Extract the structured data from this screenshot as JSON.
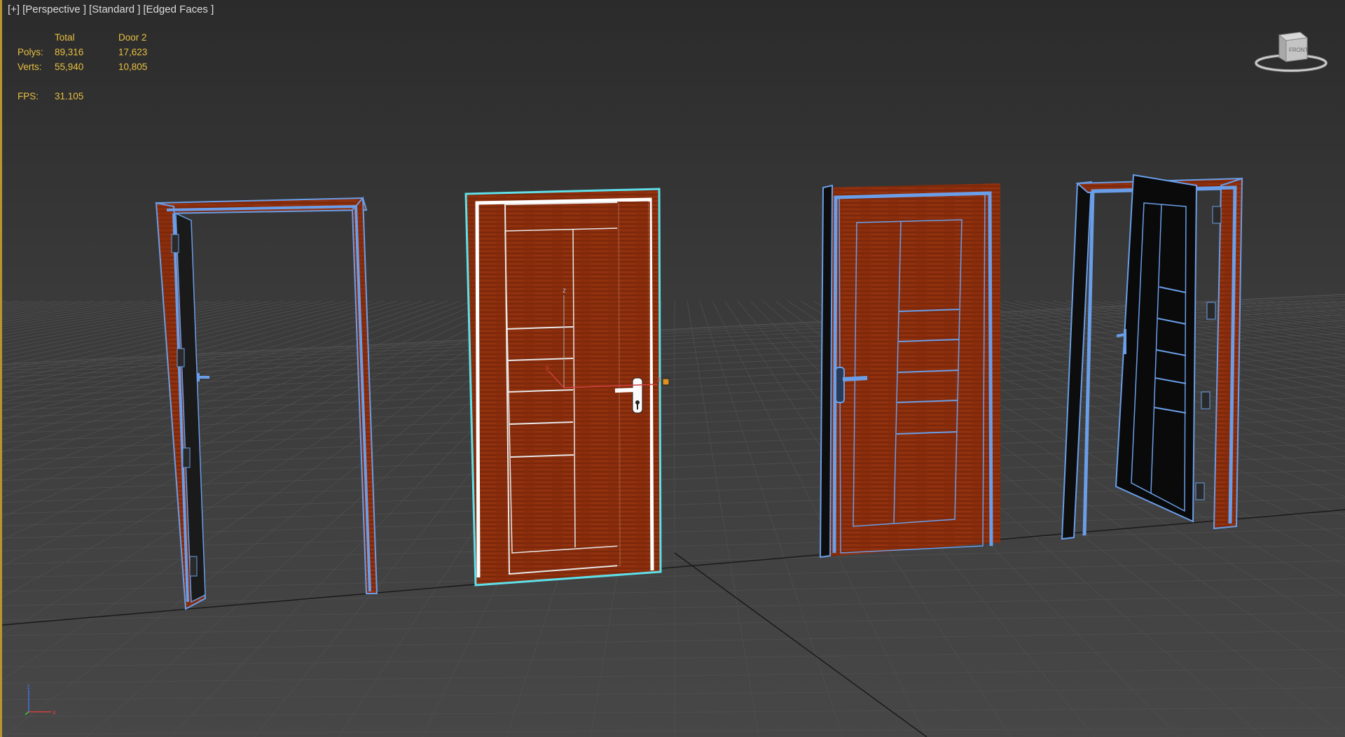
{
  "viewport": {
    "label_parts": [
      "[+]",
      "[Perspective ]",
      "[Standard ]",
      "[Edged Faces ]"
    ]
  },
  "stats": {
    "header_total": "Total",
    "header_selected": "Door 2",
    "polys_label": "Polys:",
    "polys_total": "89,316",
    "polys_selected": "17,623",
    "verts_label": "Verts:",
    "verts_total": "55,940",
    "verts_selected": "10,805",
    "fps_label": "FPS:",
    "fps_value": "31.105"
  },
  "viewcube": {
    "face_label": "FRONT"
  },
  "axes": {
    "x": "x",
    "z": "z"
  },
  "gizmo": {
    "x": "x",
    "y": "y",
    "z": "z"
  },
  "colors": {
    "wood": "#8a2d0c",
    "wireframe": "#6a9ee8",
    "selection": "#5fe0ea",
    "stats_text": "#e8c040",
    "border_accent": "#b8952e"
  }
}
